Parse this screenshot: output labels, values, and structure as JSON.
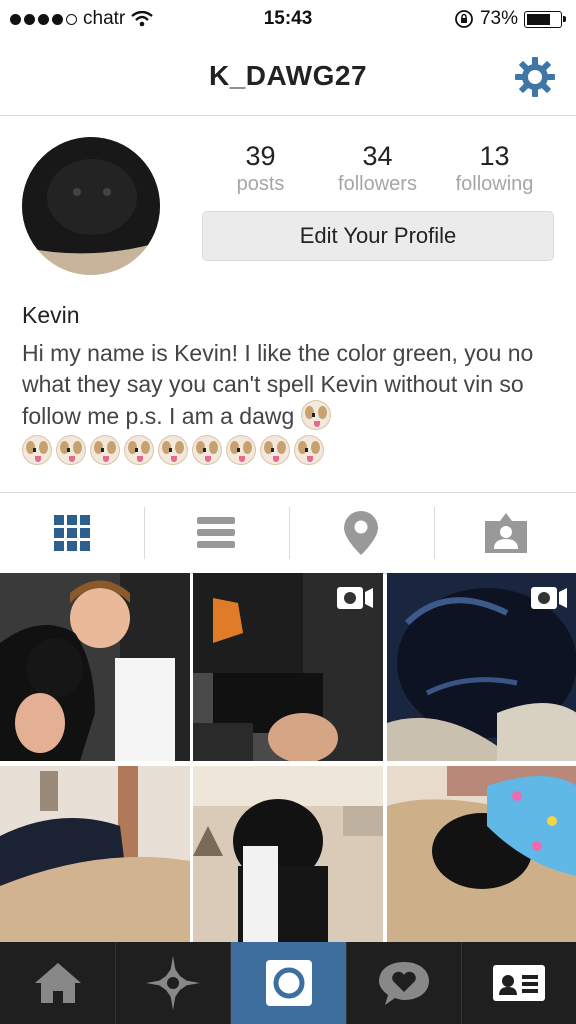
{
  "status_bar": {
    "carrier": "chatr",
    "time": "15:43",
    "battery": "73%"
  },
  "header": {
    "username": "K_DAWG27"
  },
  "profile": {
    "stats": [
      {
        "count": "39",
        "label": "posts"
      },
      {
        "count": "34",
        "label": "followers"
      },
      {
        "count": "13",
        "label": "following"
      }
    ],
    "edit_button_label": "Edit Your Profile",
    "name": "Kevin",
    "bio": "Hi my name is Kevin! I like the color green, you no what they say you can't spell Kevin without vin so follow me p.s. I am a dawg"
  },
  "tabs": [
    {
      "icon": "grid-icon"
    },
    {
      "icon": "list-icon"
    },
    {
      "icon": "location-pin-icon"
    },
    {
      "icon": "tagged-person-icon"
    }
  ],
  "bottom_nav": [
    {
      "icon": "home-icon"
    },
    {
      "icon": "explore-star-icon"
    },
    {
      "icon": "camera-icon"
    },
    {
      "icon": "activity-heart-bubble-icon"
    },
    {
      "icon": "profile-card-icon"
    }
  ],
  "colors": {
    "accent_blue": "#3e6e9e",
    "tab_active": "#2d5f8f",
    "bottom_bar": "#1f1f1f"
  }
}
